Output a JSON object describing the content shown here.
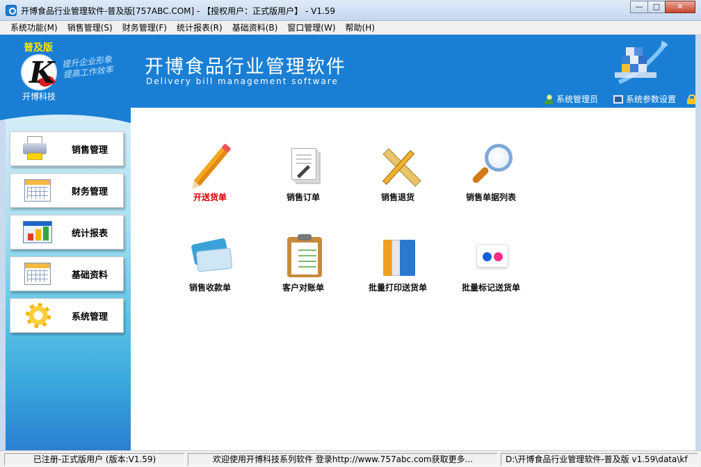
{
  "window": {
    "title": "开博食品行业管理软件-普及版[757ABC.COM] - 【授权用户：正式版用户】 - V1.59",
    "controls": {
      "minimize": "—",
      "maximize": "□",
      "close": "✕"
    }
  },
  "menubar": {
    "items": [
      "系统功能(M)",
      "销售管理(S)",
      "财务管理(F)",
      "统计报表(R)",
      "基础资料(B)",
      "窗口管理(W)",
      "帮助(H)"
    ]
  },
  "banner": {
    "edition": "普及版",
    "logo_letter": "K",
    "company": "开博科技",
    "slogan_line1": "提升企业形象",
    "slogan_line2": "提高工作效率",
    "title": "开博食品行业管理软件",
    "subtitle": "Delivery bill management software",
    "links": {
      "admin": "系统管理员",
      "settings": "系统参数设置"
    }
  },
  "sidebar": {
    "items": [
      {
        "label": "销售管理",
        "icon": "printer-icon"
      },
      {
        "label": "财务管理",
        "icon": "calendar-icon"
      },
      {
        "label": "统计报表",
        "icon": "bar-chart-icon"
      },
      {
        "label": "基础资料",
        "icon": "calendar-icon"
      },
      {
        "label": "系统管理",
        "icon": "gear-icon"
      }
    ]
  },
  "main": {
    "tiles": [
      {
        "label": "开送货单",
        "icon": "pencil-icon",
        "highlight": true
      },
      {
        "label": "销售订单",
        "icon": "document-icon"
      },
      {
        "label": "销售退货",
        "icon": "ruler-pencil-icon"
      },
      {
        "label": "销售单据列表",
        "icon": "magnifier-icon"
      },
      {
        "label": "销售收款单",
        "icon": "credit-card-icon"
      },
      {
        "label": "客户对账单",
        "icon": "clipboard-icon"
      },
      {
        "label": "批量打印送货单",
        "icon": "binders-icon"
      },
      {
        "label": "批量标记送货单",
        "icon": "dots-icon"
      }
    ]
  },
  "statusbar": {
    "registration": "已注册-正式版用户 (版本:V1.59)",
    "message": "欢迎使用开博科技系列软件  登录http://www.757abc.com获取更多...",
    "path": "D:\\开博食品行业管理软件-普及版 v1.59\\data\\kf"
  },
  "colors": {
    "banner_blue": "#1a7fd4",
    "edition_yellow": "#ffe600",
    "highlight_red": "#d20000"
  }
}
